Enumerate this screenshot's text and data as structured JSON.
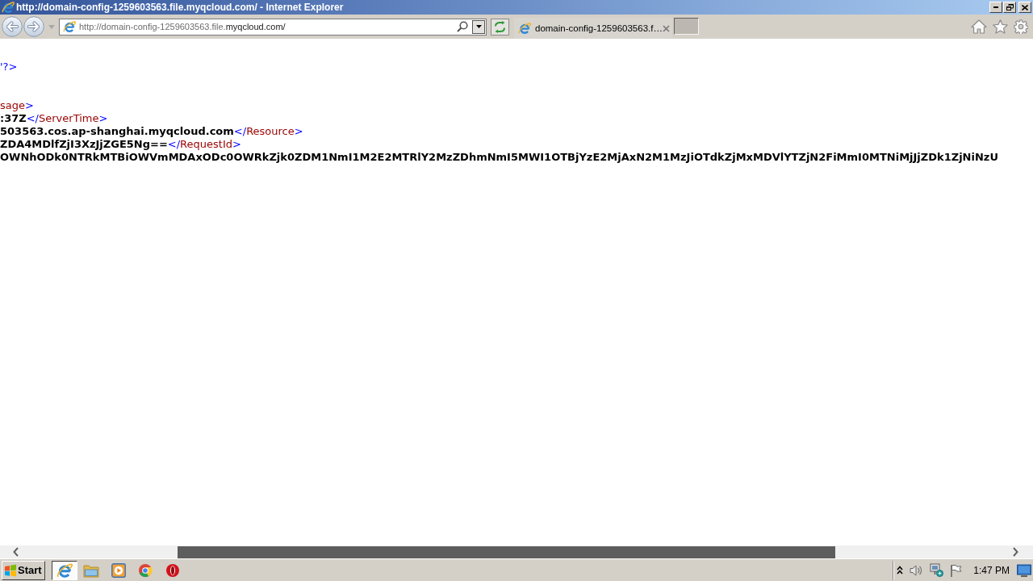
{
  "window": {
    "title": "http://domain-config-1259603563.file.myqcloud.com/ - Internet Explorer"
  },
  "address_bar": {
    "url_prefix": "http://domain-config-1259603563.file.",
    "url_host": "myqcloud.com/"
  },
  "tabs": [
    {
      "label": "domain-config-1259603563.f…",
      "selected": true
    }
  ],
  "document": {
    "lines": [
      {
        "kind": "code",
        "segments": [
          {
            "kind": "markup",
            "text": "'?>"
          }
        ]
      },
      {
        "kind": "blank"
      },
      {
        "kind": "blank"
      },
      {
        "kind": "code",
        "segments": [
          {
            "kind": "name",
            "text": "sage"
          },
          {
            "kind": "markup",
            "text": ">"
          }
        ]
      },
      {
        "kind": "code",
        "segments": [
          {
            "kind": "value",
            "text": ":37Z"
          },
          {
            "kind": "markup",
            "text": "</"
          },
          {
            "kind": "name",
            "text": "ServerTime"
          },
          {
            "kind": "markup",
            "text": ">"
          }
        ]
      },
      {
        "kind": "code",
        "segments": [
          {
            "kind": "value",
            "text": "503563.cos.ap-shanghai.myqcloud.com"
          },
          {
            "kind": "markup",
            "text": "</"
          },
          {
            "kind": "name",
            "text": "Resource"
          },
          {
            "kind": "markup",
            "text": ">"
          }
        ]
      },
      {
        "kind": "code",
        "segments": [
          {
            "kind": "value",
            "text": "ZDA4MDlfZjI3XzJjZGE5Ng=="
          },
          {
            "kind": "markup",
            "text": "</"
          },
          {
            "kind": "name",
            "text": "RequestId"
          },
          {
            "kind": "markup",
            "text": ">"
          }
        ]
      },
      {
        "kind": "code",
        "segments": [
          {
            "kind": "value",
            "text": "OWNhODk0NTRkMTBiOWVmMDAxODc0OWRkZjk0ZDM1NmI1M2E2MTRlY2MzZDhmNmI5MWI1OTBjYzE2MjAxN2M1MzJiOTdkZjMxMDVlYTZjN2FiMmI0MTNiMjJjZDk1ZjNiNzU"
          }
        ]
      }
    ]
  },
  "taskbar": {
    "start": "Start",
    "apps": [
      {
        "selected": true
      },
      {
        "selected": false
      },
      {
        "selected": false
      },
      {
        "selected": false
      },
      {
        "selected": false
      }
    ],
    "clock": "1:47 PM"
  }
}
